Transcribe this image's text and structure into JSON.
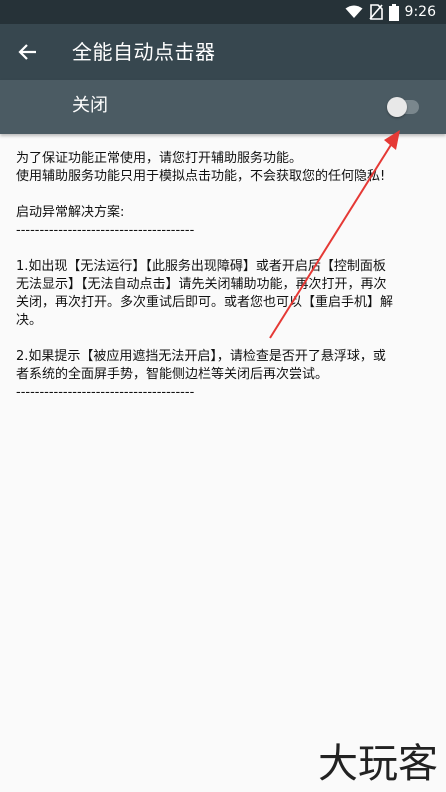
{
  "status_bar": {
    "time": "9:26",
    "icons": [
      "wifi-icon",
      "no-sim-icon",
      "battery-icon"
    ]
  },
  "app_bar": {
    "title": "全能自动点击器",
    "back_icon": "arrow-left-icon"
  },
  "service_switch": {
    "label": "关闭",
    "state": "off"
  },
  "content": {
    "lines": [
      "为了保证功能正常使用，请您打开辅助服务功能。",
      "使用辅助服务功能只用于模拟点击功能，不会获取您的任何隐私!"
    ],
    "section_title": "启动异常解决方案:",
    "divider": "--------------------------------------",
    "item1_lines": [
      "1.如出现【无法运行】【此服务出现障碍】或者开启后【控制面板",
      "无法显示】【无法自动点击】请先关闭辅助功能，再次打开，再次",
      "关闭，再次打开。多次重试后即可。或者您也可以【重启手机】解",
      "决。"
    ],
    "item2_lines": [
      " 2.如果提示【被应用遮挡无法开启】，请检查是否开了悬浮球，或",
      "者系统的全面屏手势，智能侧边栏等关闭后再次尝试。"
    ],
    "divider2": "--------------------------------------"
  },
  "watermark": "大玩客",
  "colors": {
    "status_bar": "#263238",
    "app_bar": "#37474f",
    "switch_bar": "#4b5b63",
    "arrow": "#e53935"
  }
}
